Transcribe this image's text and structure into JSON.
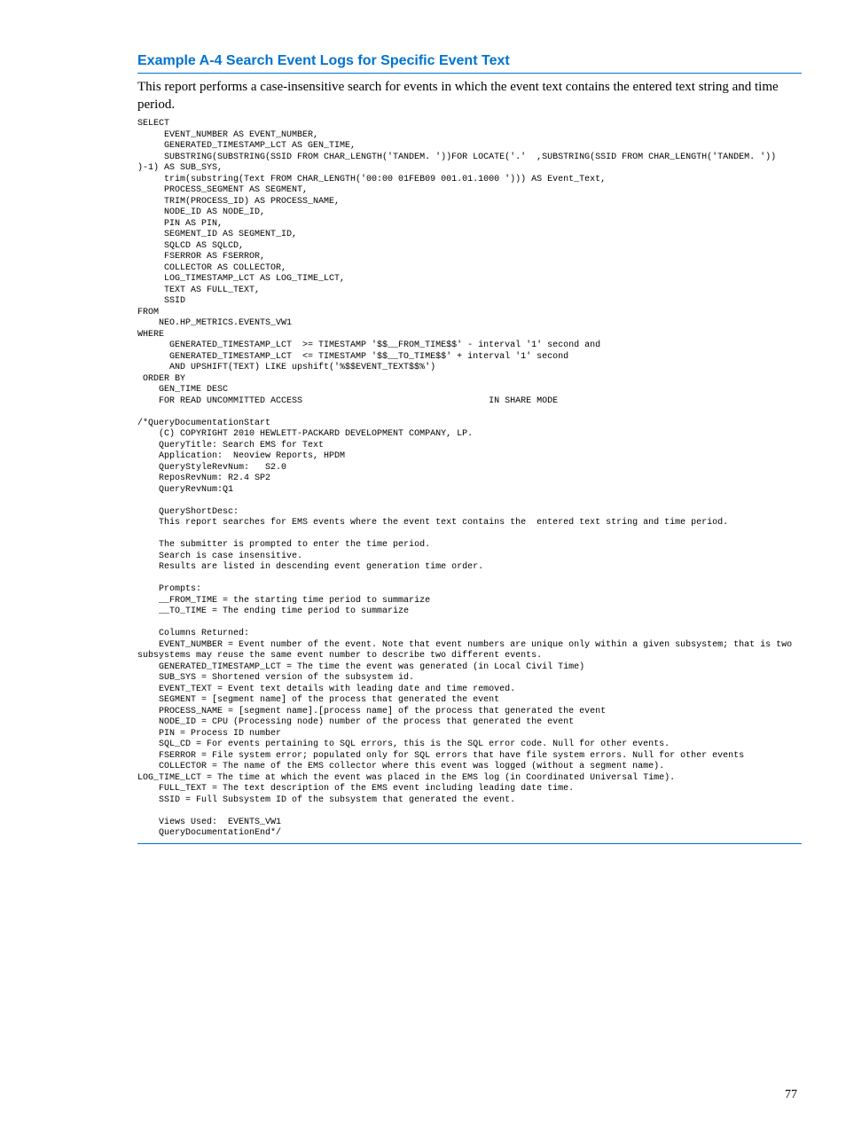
{
  "heading": "Example A-4 Search Event Logs for Specific Event Text",
  "intro": "This report performs a case-insensitive search for events in which the event text contains the entered text string and time period.",
  "code": "SELECT\n     EVENT_NUMBER AS EVENT_NUMBER,\n     GENERATED_TIMESTAMP_LCT AS GEN_TIME,\n     SUBSTRING(SUBSTRING(SSID FROM CHAR_LENGTH('TANDEM. '))FOR LOCATE('.'  ,SUBSTRING(SSID FROM CHAR_LENGTH('TANDEM. ')) )-1) AS SUB_SYS,\n     trim(substring(Text FROM CHAR_LENGTH('00:00 01FEB09 001.01.1000 '))) AS Event_Text,\n     PROCESS_SEGMENT AS SEGMENT,\n     TRIM(PROCESS_ID) AS PROCESS_NAME,\n     NODE_ID AS NODE_ID,\n     PIN AS PIN,\n     SEGMENT_ID AS SEGMENT_ID,\n     SQLCD AS SQLCD,\n     FSERROR AS FSERROR,\n     COLLECTOR AS COLLECTOR,\n     LOG_TIMESTAMP_LCT AS LOG_TIME_LCT,\n     TEXT AS FULL_TEXT,\n     SSID\nFROM\n    NEO.HP_METRICS.EVENTS_VW1\nWHERE\n      GENERATED_TIMESTAMP_LCT  >= TIMESTAMP '$$__FROM_TIME$$' - interval '1' second and\n      GENERATED_TIMESTAMP_LCT  <= TIMESTAMP '$$__TO_TIME$$' + interval '1' second\n      AND UPSHIFT(TEXT) LIKE upshift('%$$EVENT_TEXT$$%')\n ORDER BY\n    GEN_TIME DESC\n    FOR READ UNCOMMITTED ACCESS                                   IN SHARE MODE\n\n/*QueryDocumentationStart\n    (C) COPYRIGHT 2010 HEWLETT-PACKARD DEVELOPMENT COMPANY, LP.\n    QueryTitle: Search EMS for Text\n    Application:  Neoview Reports, HPDM\n    QueryStyleRevNum:   S2.0\n    ReposRevNum: R2.4 SP2\n    QueryRevNum:Q1\n\n    QueryShortDesc:\n    This report searches for EMS events where the event text contains the  entered text string and time period.\n\n    The submitter is prompted to enter the time period.\n    Search is case insensitive.\n    Results are listed in descending event generation time order.\n\n    Prompts:\n    __FROM_TIME = the starting time period to summarize\n    __TO_TIME = The ending time period to summarize\n\n    Columns Returned:\n    EVENT_NUMBER = Event number of the event. Note that event numbers are unique only within a given subsystem; that is two subsystems may reuse the same event number to describe two different events.\n    GENERATED_TIMESTAMP_LCT = The time the event was generated (in Local Civil Time)\n    SUB_SYS = Shortened version of the subsystem id.\n    EVENT_TEXT = Event text details with leading date and time removed.\n    SEGMENT = [segment name] of the process that generated the event\n    PROCESS_NAME = [segment name].[process name] of the process that generated the event\n    NODE_ID = CPU (Processing node) number of the process that generated the event\n    PIN = Process ID number\n    SQL_CD = For events pertaining to SQL errors, this is the SQL error code. Null for other events.\n    FSERROR = File system error; populated only for SQL errors that have file system errors. Null for other events\n    COLLECTOR = The name of the EMS collector where this event was logged (without a segment name).\nLOG_TIME_LCT = The time at which the event was placed in the EMS log (in Coordinated Universal Time).\n    FULL_TEXT = The text description of the EMS event including leading date time.\n    SSID = Full Subsystem ID of the subsystem that generated the event.\n\n    Views Used:  EVENTS_VW1\n    QueryDocumentationEnd*/",
  "page_number": "77"
}
